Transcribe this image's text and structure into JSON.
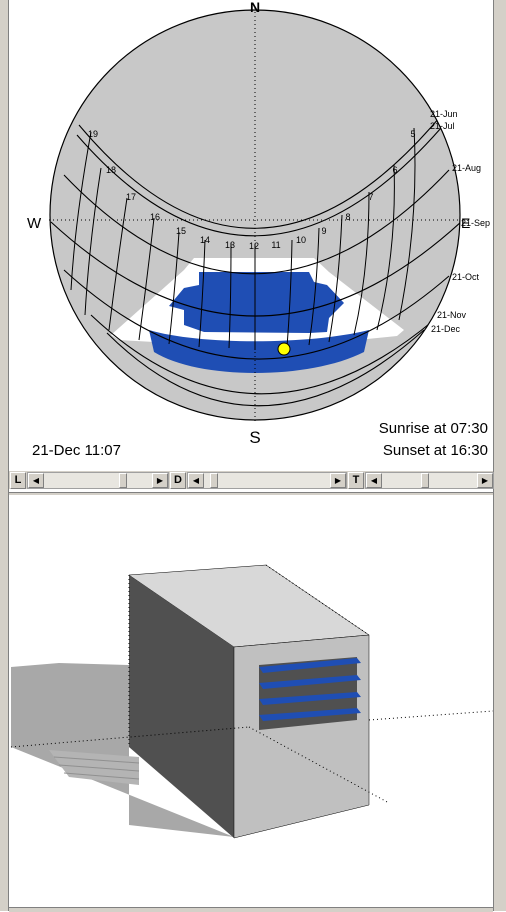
{
  "sunpath": {
    "compass": {
      "north": "N",
      "south": "S",
      "west": "W",
      "east": "E"
    },
    "date_labels": [
      "21-Jun",
      "21-Jul",
      "21-Aug",
      "21-Sep",
      "21-Oct",
      "21-Nov",
      "21-Dec"
    ],
    "hour_labels": [
      "5",
      "6",
      "7",
      "8",
      "9",
      "10",
      "11",
      "12",
      "13",
      "14",
      "15",
      "16",
      "17",
      "18",
      "19"
    ],
    "current_datetime": "21-Dec 11:07",
    "sunrise": "Sunrise at 07:30",
    "sunset": "Sunset at 16:30",
    "colors": {
      "dome": "#c8c8c8",
      "shading": "#1f4eb4",
      "sun": "#ffff00",
      "grid": "#000000"
    }
  },
  "controls": {
    "sliders": [
      {
        "label": "L",
        "value": 0.75
      },
      {
        "label": "D",
        "value": 0.05
      },
      {
        "label": "T",
        "value": 0.45
      }
    ]
  },
  "view3d": {
    "colors": {
      "front": "#c0c0c0",
      "top": "#d8d8d8",
      "side": "#505050",
      "shadow": "#a8a8a8",
      "louvers": "#1f4eb4"
    }
  }
}
